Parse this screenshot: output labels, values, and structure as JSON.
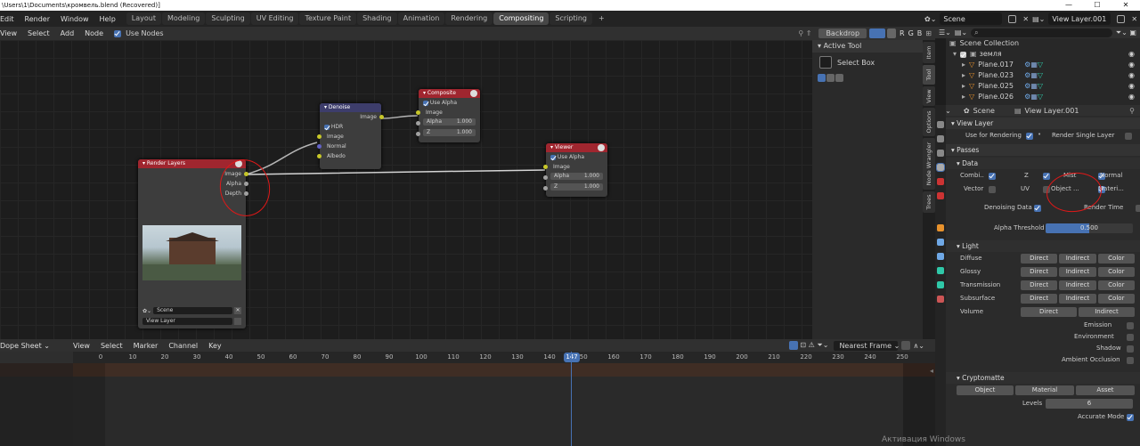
{
  "titlebar": {
    "path": "\\Users\\1\\Documents\\кромвель.blend (Recovered)]",
    "controls": [
      "—",
      "☐",
      "✕"
    ]
  },
  "menus": [
    "Edit",
    "Render",
    "Window",
    "Help"
  ],
  "workspaces": [
    "Layout",
    "Modeling",
    "Sculpting",
    "UV Editing",
    "Texture Paint",
    "Shading",
    "Animation",
    "Rendering",
    "Compositing",
    "Scripting",
    "+"
  ],
  "scene_name": "Scene",
  "view_layer_name": "View Layer.001",
  "node_header": {
    "menus": [
      "View",
      "Select",
      "Add",
      "Node"
    ],
    "use_nodes": "Use Nodes",
    "backdrop": "Backdrop",
    "channels": [
      "R",
      "G",
      "B"
    ]
  },
  "nodes": {
    "render_layers": {
      "title": "Render Layers",
      "outputs": [
        "Image",
        "Alpha",
        "Depth"
      ],
      "scene": "Scene",
      "layer": "View Layer"
    },
    "denoise": {
      "title": "Denoise",
      "output": "Image",
      "hdr": "HDR",
      "inputs": [
        "Image",
        "Normal",
        "Albedo"
      ]
    },
    "composite": {
      "title": "Composite",
      "use_alpha": "Use Alpha",
      "image": "Image",
      "alpha_label": "Alpha",
      "alpha_value": "1.000",
      "z_label": "Z",
      "z_value": "1.000"
    },
    "viewer": {
      "title": "Viewer",
      "use_alpha": "Use Alpha",
      "image": "Image",
      "alpha_label": "Alpha",
      "alpha_value": "1.000",
      "z_label": "Z",
      "z_value": "1.000"
    }
  },
  "tool_panel": {
    "title": "Active Tool",
    "select_box": "Select Box"
  },
  "side_tabs": [
    "Item",
    "Tool",
    "View",
    "Options",
    "Node Wrangler",
    "Trees"
  ],
  "dope_header": {
    "editor": "Dope Sheet",
    "menus": [
      "View",
      "Select",
      "Marker",
      "Channel",
      "Key"
    ],
    "interpolation": "Nearest Frame"
  },
  "timeline": {
    "ticks": [
      "0",
      "10",
      "20",
      "30",
      "40",
      "50",
      "60",
      "70",
      "80",
      "90",
      "100",
      "110",
      "120",
      "130",
      "140",
      "150",
      "160",
      "170",
      "180",
      "190",
      "200",
      "210",
      "220",
      "230",
      "240",
      "250"
    ],
    "current_frame": "147"
  },
  "outliner": {
    "search_placeholder": "",
    "collection": "Scene Collection",
    "group": "земля",
    "objects": [
      "Plane.017",
      "Plane.023",
      "Plane.025",
      "Plane.026"
    ]
  },
  "properties": {
    "view_layer": "View Layer",
    "use_for_rendering": "Use for Rendering",
    "render_single_layer": "Render Single Layer",
    "passes": "Passes",
    "data": "Data",
    "data_row1": [
      "Combi..",
      "Z",
      "Mist",
      "Normal"
    ],
    "data_row2": [
      "Vector",
      "UV",
      "Object ...",
      "Materi..."
    ],
    "denoising_data": "Denoising Data",
    "render_time": "Render Time",
    "alpha_threshold": "Alpha Threshold",
    "alpha_threshold_value": "0.500",
    "light": "Light",
    "light_rows": [
      {
        "label": "Diffuse",
        "btns": [
          "Direct",
          "Indirect",
          "Color"
        ]
      },
      {
        "label": "Glossy",
        "btns": [
          "Direct",
          "Indirect",
          "Color"
        ]
      },
      {
        "label": "Transmission",
        "btns": [
          "Direct",
          "Indirect",
          "Color"
        ]
      },
      {
        "label": "Subsurface",
        "btns": [
          "Direct",
          "Indirect",
          "Color"
        ]
      },
      {
        "label": "Volume",
        "btns": [
          "Direct",
          "Indirect"
        ]
      }
    ],
    "light_checks": [
      "Emission",
      "Environment",
      "Shadow",
      "Ambient Occlusion"
    ],
    "cryptomatte": "Cryptomatte",
    "crypto_btns": [
      "Object",
      "Material",
      "Asset"
    ],
    "levels": "Levels",
    "levels_value": "6",
    "accurate_mode": "Accurate Mode"
  },
  "watermark": "Активация Windows"
}
